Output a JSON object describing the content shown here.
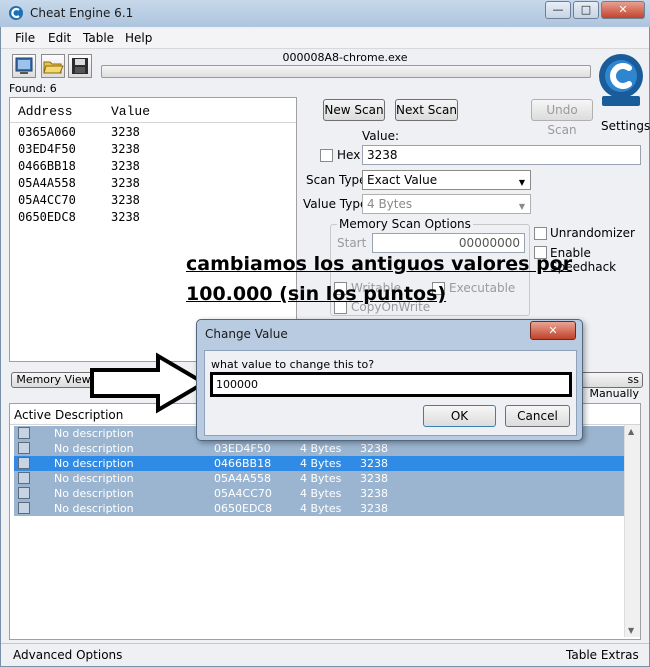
{
  "window": {
    "title": "Cheat Engine 6.1",
    "min": "—",
    "max": "□",
    "close": "✕"
  },
  "menu": [
    "File",
    "Edit",
    "Table",
    "Help"
  ],
  "toolbar": {
    "icons": [
      "open-process-icon",
      "open-file-icon",
      "save-icon"
    ]
  },
  "process": {
    "name": "000008A8-chrome.exe"
  },
  "found": "Found: 6",
  "results": {
    "headers": {
      "address": "Address",
      "value": "Value"
    },
    "rows": [
      {
        "address": "0365A060",
        "value": "3238"
      },
      {
        "address": "03ED4F50",
        "value": "3238"
      },
      {
        "address": "0466BB18",
        "value": "3238"
      },
      {
        "address": "05A4A558",
        "value": "3238"
      },
      {
        "address": "05A4CC70",
        "value": "3238"
      },
      {
        "address": "0650EDC8",
        "value": "3238"
      }
    ]
  },
  "scan": {
    "new_scan": "New Scan",
    "next_scan": "Next Scan",
    "undo_scan": "Undo Scan",
    "settings": "Settings",
    "value_label": "Value:",
    "hex_label": "Hex",
    "value": "3238",
    "scan_type_label": "Scan Type",
    "scan_type": "Exact Value",
    "value_type_label": "Value Type",
    "value_type": "4 Bytes",
    "memory_options": "Memory Scan Options",
    "start_label": "Start",
    "start_value": "00000000",
    "writable": "Writable",
    "executable": "Executable",
    "copyonwrite": "CopyOnWrite",
    "unrandomizer": "Unrandomizer",
    "speedhack": "Enable Speedhack"
  },
  "annotation": {
    "line1": "cambiamos los antiguos valores por",
    "line2": "100.000 (sin los puntos)"
  },
  "memory_view": "Memory View",
  "add_manually": "ss Manually",
  "cheat_table": {
    "headers": {
      "active": "Active",
      "description": "Description"
    },
    "rows": [
      {
        "description": "No description",
        "address": "",
        "type": "",
        "value": ""
      },
      {
        "description": "No description",
        "address": "03ED4F50",
        "type": "4 Bytes",
        "value": "3238"
      },
      {
        "description": "No description",
        "address": "0466BB18",
        "type": "4 Bytes",
        "value": "3238"
      },
      {
        "description": "No description",
        "address": "05A4A558",
        "type": "4 Bytes",
        "value": "3238"
      },
      {
        "description": "No description",
        "address": "05A4CC70",
        "type": "4 Bytes",
        "value": "3238"
      },
      {
        "description": "No description",
        "address": "0650EDC8",
        "type": "4 Bytes",
        "value": "3238"
      }
    ]
  },
  "status": {
    "advanced": "Advanced Options",
    "extras": "Table Extras"
  },
  "dialog": {
    "title": "Change Value",
    "prompt": "what value to change this to?",
    "value": "100000",
    "ok": "OK",
    "cancel": "Cancel",
    "close": "✕"
  }
}
